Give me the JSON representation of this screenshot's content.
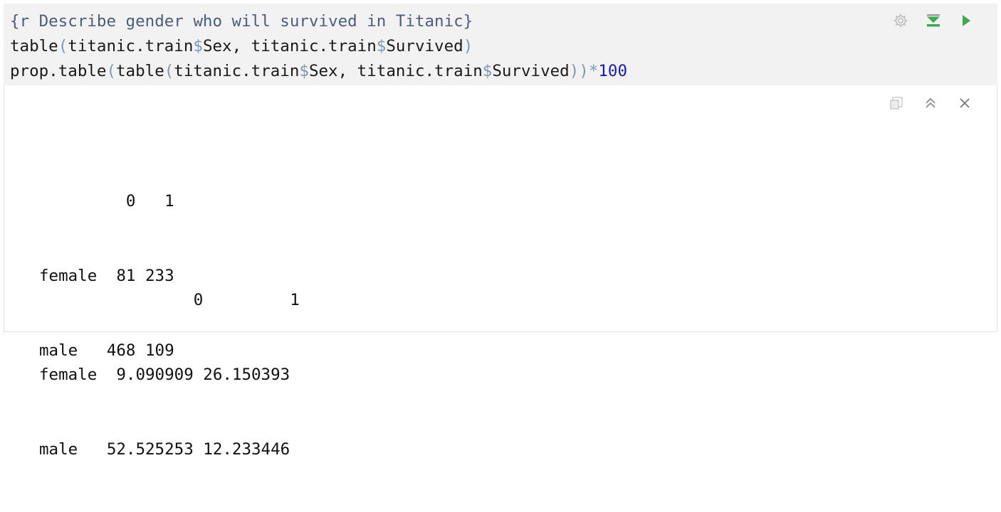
{
  "chunk": {
    "line1": "{r Describe gender who will survived in Titanic}",
    "line2": {
      "p1": "table",
      "p2": "(",
      "p3": "titanic.train",
      "p4": "$",
      "p5": "Sex, titanic.train",
      "p6": "$",
      "p7": "Survived",
      "p8": ")"
    },
    "line3": {
      "p1": "prop.table",
      "p2": "(",
      "p3": "table",
      "p4": "(",
      "p5": "titanic.train",
      "p6": "$",
      "p7": "Sex, titanic.train",
      "p8": "$",
      "p9": "Survived",
      "p10": "))",
      "p11": "*",
      "p12": "100"
    },
    "tools": {
      "settings_icon": "gear-icon",
      "run_above_icon": "run-previous-chunks-icon",
      "run_icon": "run-chunk-icon"
    },
    "colors": {
      "chunk_bg": "#f2f2f2",
      "header": "#4c5d7c",
      "operator": "#7d9ab4",
      "number": "#1b1bb4",
      "run_green": "#3cab4f"
    }
  },
  "output": {
    "tools": {
      "expand_icon": "show-in-new-window-icon",
      "collapse_icon": "collapse-output-icon",
      "close_icon": "clear-output-icon"
    },
    "table1": {
      "header": "         0   1",
      "rows": [
        "female  81 233",
        "male   468 109"
      ]
    },
    "table2": {
      "header": "                0         1",
      "rows": [
        "female  9.090909 26.150393",
        "male   52.525253 12.233446"
      ]
    }
  }
}
